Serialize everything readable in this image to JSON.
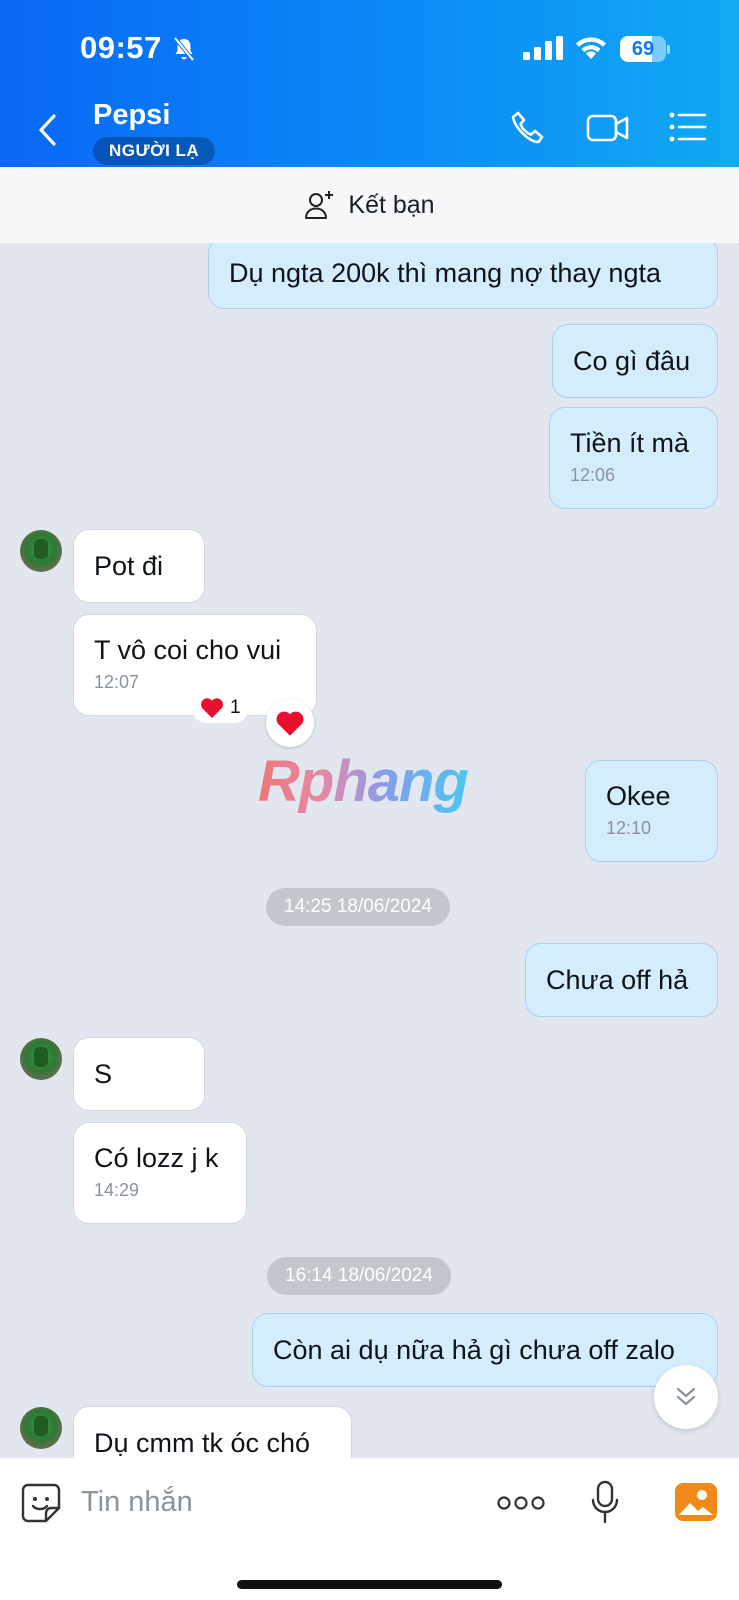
{
  "status_bar": {
    "time": "09:57",
    "battery": "69",
    "battery_level": 0.69
  },
  "header": {
    "name": "Pepsi",
    "badge": "NGƯỜI LẠ"
  },
  "friend_bar": {
    "label": "Kết bạn"
  },
  "messages": [
    {
      "text": "Dụ ngta 200k thì mang nợ thay ngta"
    },
    {
      "text": "Co gì đâu"
    },
    {
      "text": "Tiền ít mà",
      "time": "12:06"
    },
    {
      "text": "Pot đi"
    },
    {
      "text": "T vô coi cho vui",
      "time": "12:07",
      "reaction_count": "1"
    },
    {
      "text": "Okee",
      "time": "12:10"
    },
    {
      "text": "Chưa off hả"
    },
    {
      "text": "S"
    },
    {
      "text": "Có lozz j k",
      "time": "14:29"
    },
    {
      "text": "Còn ai dụ nữa hả gì chưa off zalo"
    },
    {
      "text": "Dụ cmm tk óc chó"
    }
  ],
  "date_separators": [
    "14:25 18/06/2024",
    "16:14 18/06/2024"
  ],
  "watermark": "Rphang",
  "input": {
    "placeholder": "Tin nhắn"
  }
}
